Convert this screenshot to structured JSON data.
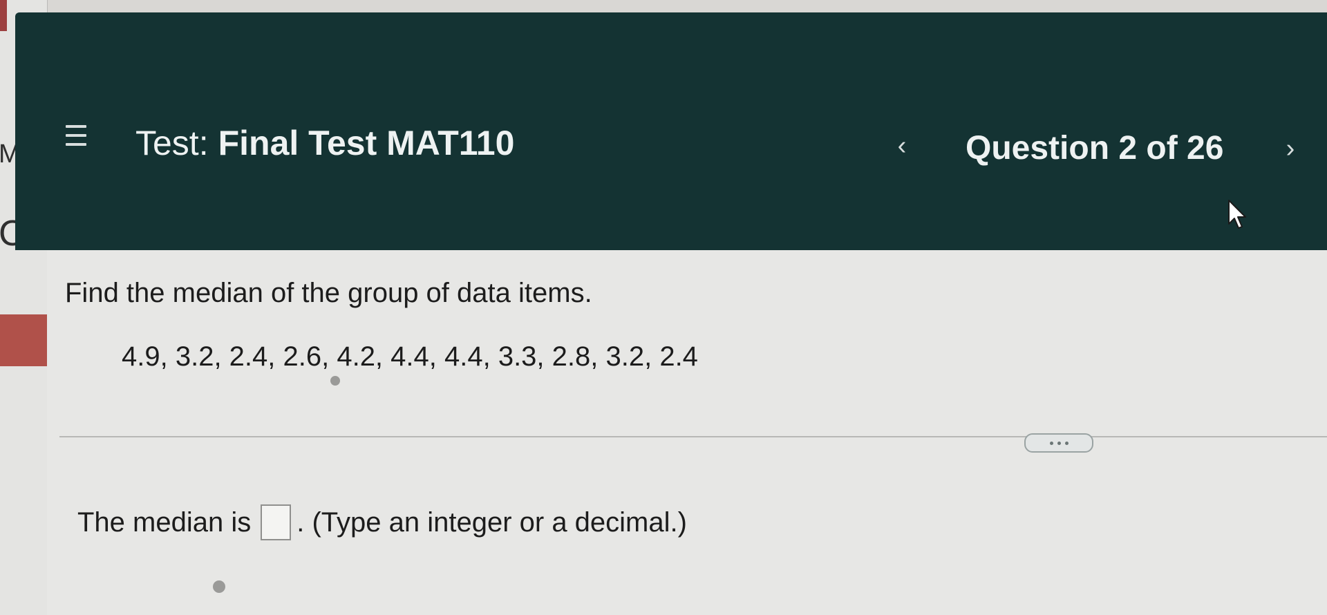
{
  "header": {
    "test_label": "Test:",
    "test_name": "Final Test MAT110",
    "question_counter": "Question 2 of 26",
    "icons": {
      "menu": "hamburger-menu-icon",
      "previous": "chevron-left-icon",
      "next": "chevron-right-icon"
    }
  },
  "question": {
    "prompt": "Find the median of the group of data items.",
    "data_items": "4.9, 3.2, 2.4, 2.6, 4.2, 4.4, 4.4, 3.3, 2.8, 3.2, 2.4",
    "more_button_icon": "ellipsis-icon"
  },
  "answer": {
    "prefix": "The median is",
    "value": "",
    "suffix": ". (Type an integer or a decimal.)"
  },
  "colors": {
    "header_background": "#143333",
    "header_text": "#eef2f2",
    "content_background": "#e7e7e5"
  }
}
